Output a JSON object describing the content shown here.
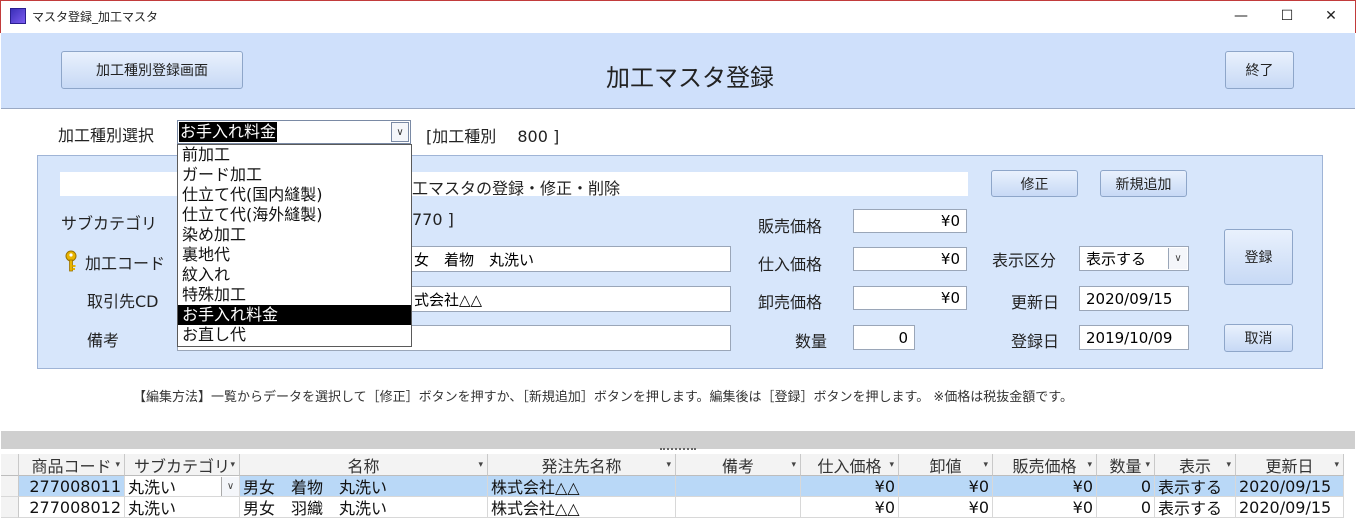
{
  "window": {
    "title": "マスタ登録_加工マスタ",
    "minimize": "—",
    "maximize": "☐",
    "close": "✕"
  },
  "header": {
    "left_button": "加工種別登録画面",
    "title": "加工マスタ登録",
    "exit_button": "終了"
  },
  "type_select": {
    "label": "加工種別選択",
    "selected": "お手入れ料金",
    "code_text": "[加工種別　 800 ]",
    "options": [
      "前加工",
      "ガード加工",
      "仕立て代(国内縫製)",
      "仕立て代(海外縫製)",
      "染め加工",
      "裏地代",
      "紋入れ",
      "特殊加工",
      "お手入れ料金",
      "お直し代"
    ],
    "selected_index": 8
  },
  "form": {
    "section_title": "工マスタの登録・修正・削除",
    "edit_button": "修正",
    "new_button": "新規追加",
    "register_button": "登録",
    "cancel_button": "取消",
    "subcategory_label": "サブカテゴリ",
    "subcategory_value": "770 ]",
    "code_label": "加工コード",
    "name_value": "女　着物　丸洗い",
    "supplier_label": "取引先CD",
    "supplier_value": "式会社△△",
    "memo_label": "備考",
    "sale_price_label": "販売価格",
    "sale_price": "¥0",
    "purchase_price_label": "仕入価格",
    "purchase_price": "¥0",
    "wholesale_price_label": "卸売価格",
    "wholesale_price": "¥0",
    "quantity_label": "数量",
    "quantity": "0",
    "display_label": "表示区分",
    "display_value": "表示する",
    "updated_label": "更新日",
    "updated_value": "2020/09/15",
    "registered_label": "登録日",
    "registered_value": "2019/10/09"
  },
  "instructions": "【編集方法】一覧からデータを選択して［修正］ボタンを押すか、［新規追加］ボタンを押します。編集後は［登録］ボタンを押します。 ※価格は税抜金額です。",
  "table": {
    "columns": [
      "商品コード",
      "サブカテゴリ",
      "名称",
      "発注先名称",
      "備考",
      "仕入価格",
      "卸値",
      "販売価格",
      "数量",
      "表示",
      "更新日"
    ],
    "rows": [
      [
        "277008011",
        "丸洗い",
        "男女　着物　丸洗い",
        "株式会社△△",
        "",
        "¥0",
        "¥0",
        "¥0",
        "0",
        "表示する",
        "2020/09/15"
      ],
      [
        "277008012",
        "丸洗い",
        "男女　羽織　丸洗い",
        "株式会社△△",
        "",
        "¥0",
        "¥0",
        "¥0",
        "0",
        "表示する",
        "2020/09/15"
      ]
    ]
  },
  "colors": {
    "header_bg": "#cfe0fb",
    "panel_bg": "#d7e6fb",
    "selected_row": "#b9d8f7",
    "window_border": "#c23b3b"
  }
}
